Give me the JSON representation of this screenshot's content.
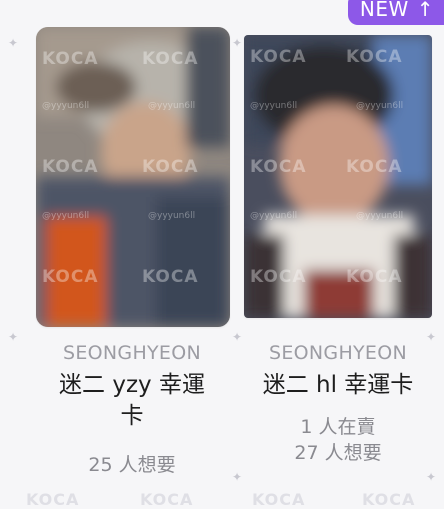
{
  "cards": [
    {
      "artist": "SEONGHYEON",
      "title_line1": "迷二 yzy 幸運",
      "title_line2": "卡",
      "want": "25 人想要"
    },
    {
      "badge": "NEW",
      "badge_icon": "arrow-up-icon",
      "artist": "SEONGHYEON",
      "title_line1": "迷二 hl 幸運卡",
      "selling": "1 人在賣",
      "want": "27 人想要"
    }
  ],
  "colors": {
    "badge_bg": "#8d58e8",
    "artist_text": "#9c9ca3",
    "title_text": "#1e1e1e",
    "stat_text": "#8a8a90",
    "background": "#f6f6f8"
  },
  "watermark": {
    "brand": "KOCA",
    "handle": "@yyyun6ll"
  }
}
